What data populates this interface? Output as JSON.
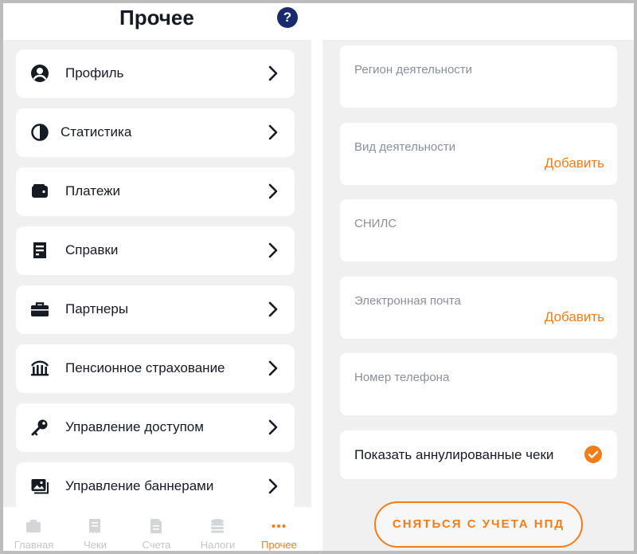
{
  "header": {
    "title": "Прочее",
    "help_label": "?"
  },
  "menu": [
    {
      "label": "Профиль",
      "icon": "person-icon"
    },
    {
      "label": "Статистика",
      "icon": "pie-chart-icon"
    },
    {
      "label": "Платежи",
      "icon": "wallet-icon"
    },
    {
      "label": "Справки",
      "icon": "document-icon"
    },
    {
      "label": "Партнеры",
      "icon": "briefcase-icon"
    },
    {
      "label": "Пенсионное страхование",
      "icon": "pension-fund-icon"
    },
    {
      "label": "Управление доступом",
      "icon": "key-icon"
    },
    {
      "label": "Управление баннерами",
      "icon": "image-icon"
    }
  ],
  "tabs": [
    {
      "label": "Главная",
      "icon": "home-icon",
      "active": false
    },
    {
      "label": "Чеки",
      "icon": "receipt-icon",
      "active": false
    },
    {
      "label": "Счета",
      "icon": "invoice-icon",
      "active": false
    },
    {
      "label": "Налоги",
      "icon": "coins-icon",
      "active": false
    },
    {
      "label": "Прочее",
      "icon": "more-dots-icon",
      "active": true
    }
  ],
  "profile_fields": [
    {
      "label": "Регион деятельности",
      "action": ""
    },
    {
      "label": "Вид деятельности",
      "action": "Добавить"
    },
    {
      "label": "СНИЛС",
      "action": ""
    },
    {
      "label": "Электронная почта",
      "action": "Добавить"
    },
    {
      "label": "Номер телефона",
      "action": ""
    }
  ],
  "toggle": {
    "label": "Показать аннулированные чеки",
    "checked": true
  },
  "npd_button": {
    "label": "СНЯТЬСЯ С УЧЕТА НПД"
  },
  "colors": {
    "accent": "#ef7d1a",
    "help": "#1a2b6d",
    "text": "#161a22",
    "muted": "#8a8f98",
    "tab_inactive": "#c2c5cb",
    "background": "#f0f0f1"
  }
}
